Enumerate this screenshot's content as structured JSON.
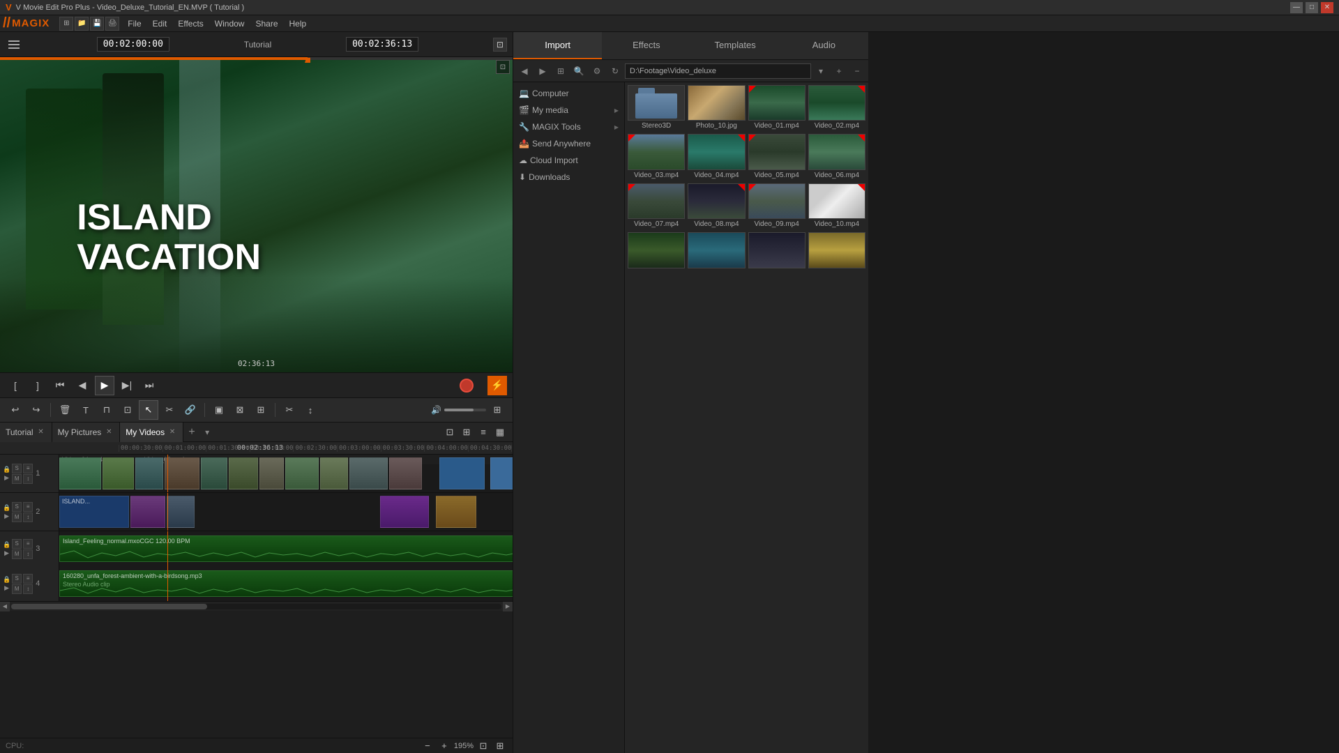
{
  "titleBar": {
    "appName": "V Movie Edit Pro Plus - Video_Deluxe_Tutorial_EN.MVP ( Tutorial )",
    "winBtns": [
      "—",
      "□",
      "✕"
    ]
  },
  "menuBar": {
    "logoText": "MAGIX",
    "items": [
      "File",
      "Edit",
      "Effects",
      "Window",
      "Share",
      "Help"
    ]
  },
  "preview": {
    "label": "Tutorial",
    "timecode": "00:02:36:13",
    "timelineTime": "02:36:13",
    "title1": "ISLAND",
    "title2": "VACATION"
  },
  "panelTabs": [
    {
      "id": "import",
      "label": "Import",
      "active": true
    },
    {
      "id": "effects",
      "label": "Effects",
      "active": false
    },
    {
      "id": "templates",
      "label": "Templates",
      "active": false
    },
    {
      "id": "audio",
      "label": "Audio",
      "active": false
    }
  ],
  "panelToolbar": {
    "pathValue": "D:\\Footage\\Video_deluxe"
  },
  "sidebarTree": [
    {
      "id": "computer",
      "label": "Computer",
      "hasArrow": false
    },
    {
      "id": "my-media",
      "label": "My media",
      "hasArrow": true
    },
    {
      "id": "magix-tools",
      "label": "MAGIX Tools",
      "hasArrow": true
    },
    {
      "id": "send-anywhere",
      "label": "Send Anywhere",
      "hasArrow": false
    },
    {
      "id": "cloud-import",
      "label": "Cloud Import",
      "hasArrow": false
    },
    {
      "id": "downloads",
      "label": "Downloads",
      "hasArrow": false
    }
  ],
  "mediaItems": [
    {
      "id": "stereo3d",
      "label": "Stereo3D",
      "thumbType": "folder"
    },
    {
      "id": "photo10",
      "label": "Photo_10.jpg",
      "thumbType": "photo"
    },
    {
      "id": "video01",
      "label": "Video_01.mp4",
      "thumbType": "waterfall",
      "hasRedCorner": true
    },
    {
      "id": "video02",
      "label": "Video_02.mp4",
      "thumbType": "waterfall2",
      "hasRedCorner": true
    },
    {
      "id": "video03",
      "label": "Video_03.mp4",
      "thumbType": "mountain",
      "hasRedCorner": true
    },
    {
      "id": "video04",
      "label": "Video_04.mp4",
      "thumbType": "lake",
      "hasRedCorner": true
    },
    {
      "id": "video05",
      "label": "Video_05.mp4",
      "thumbType": "road",
      "hasRedCorner": true
    },
    {
      "id": "video06",
      "label": "Video_06.mp4",
      "thumbType": "waterfall",
      "hasRedCorner": true
    },
    {
      "id": "video07",
      "label": "Video_07.mp4",
      "thumbType": "hill",
      "hasRedCorner": true
    },
    {
      "id": "video08",
      "label": "Video_08.mp4",
      "thumbType": "birds",
      "hasRedCorner": true
    },
    {
      "id": "video09",
      "label": "Video_09.mp4",
      "thumbType": "terrain",
      "hasRedCorner": true
    },
    {
      "id": "video10",
      "label": "Video_10.mp4",
      "thumbType": "waterfall2",
      "hasRedCorner": true
    },
    {
      "id": "video11",
      "label": "",
      "thumbType": "forest1",
      "hasRedCorner": false
    },
    {
      "id": "video12",
      "label": "",
      "thumbType": "lake",
      "hasRedCorner": false
    },
    {
      "id": "video13",
      "label": "",
      "thumbType": "birds",
      "hasRedCorner": false
    },
    {
      "id": "video14",
      "label": "",
      "thumbType": "gold",
      "hasRedCorner": false
    }
  ],
  "timelineTabs": [
    {
      "id": "tutorial",
      "label": "Tutorial",
      "active": false
    },
    {
      "id": "my-pictures",
      "label": "My Pictures",
      "active": false
    },
    {
      "id": "my-videos",
      "label": "My Videos",
      "active": true
    }
  ],
  "timelineTimecode": "00:02:36:13",
  "tracks": [
    {
      "num": "1",
      "type": "video"
    },
    {
      "num": "2",
      "type": "video"
    },
    {
      "num": "3",
      "type": "audio"
    },
    {
      "num": "4",
      "type": "audio"
    }
  ],
  "trackLabels": {
    "s": "S",
    "m": "M"
  },
  "audioClips": {
    "track3": "Island_Feeling_normal.mxoCGC  120.00 BPM",
    "track4": "160280_unfa_forest-ambient-with-a-birdsong.mp3"
  },
  "statusBar": {
    "cpuLabel": "CPU:",
    "zoomLevel": "195%"
  },
  "transport": {
    "buttons": [
      "[",
      "]",
      "⏮",
      "⏭",
      "▶",
      "⏭"
    ]
  }
}
